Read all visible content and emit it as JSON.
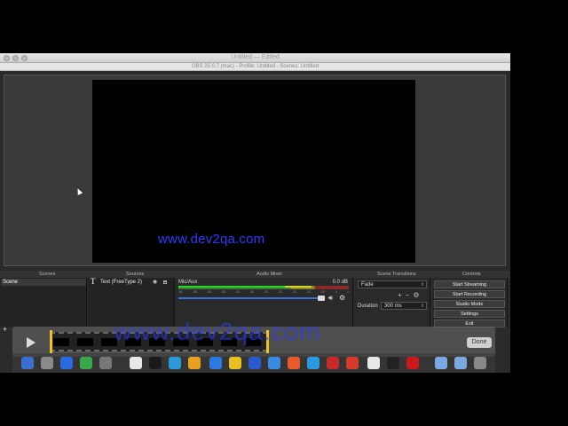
{
  "window": {
    "mac_title": "Untitled — Edited",
    "obs_title": "OBS 25.0.7 (mac) - Profile: Untitled - Scenes: Untitled"
  },
  "preview": {
    "overlay_text": "www.dev2qa.com"
  },
  "docks": {
    "scenes": "Scenes",
    "sources": "Sources",
    "mixer": "Audio Mixer",
    "transitions": "Scene Transitions",
    "controls": "Controls"
  },
  "scenes": {
    "items": [
      "Scene"
    ],
    "add": "+"
  },
  "sources": {
    "items": [
      {
        "label": "Text (FreeType 2)"
      }
    ]
  },
  "mixer": {
    "channel": "Mic/Aux",
    "db": "0.0 dB",
    "ticks": [
      "-60",
      "-55",
      "-50",
      "-45",
      "-40",
      "-35",
      "-30",
      "-25",
      "-20",
      "-15",
      "-10",
      "-5",
      "0"
    ]
  },
  "transitions": {
    "selected": "Fade",
    "duration_label": "Duration",
    "duration_value": "300 ms"
  },
  "controls": {
    "start_streaming": "Start Streaming",
    "start_recording": "Start Recording",
    "studio_mode": "Studio Mode",
    "settings": "Settings",
    "exit": "Exit"
  },
  "player": {
    "watermark": "www.dev2qa.com",
    "done": "Done"
  },
  "colors": {
    "accent_blue": "#2a3cff",
    "fader_blue": "#3a6ed8",
    "handle_yellow": "#f0c020"
  }
}
